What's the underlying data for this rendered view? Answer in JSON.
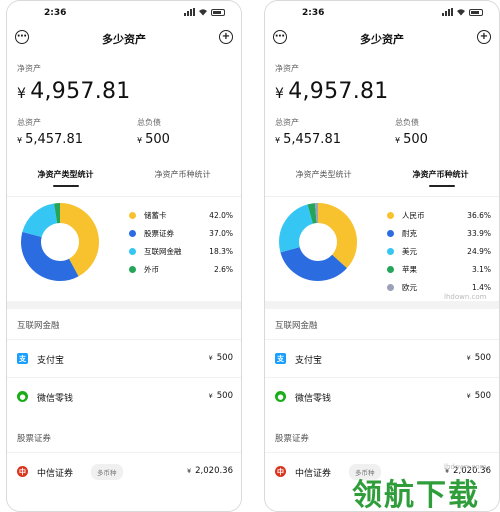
{
  "colors": {
    "yellow": "#f7c22e",
    "blue": "#2b6ce0",
    "cyan": "#35c6f4",
    "green": "#25a55a",
    "gray": "#9aa1b8",
    "alipay": "#1a9fff",
    "wechat": "#1aad19",
    "citic": "#d9341f"
  },
  "screens": [
    {
      "status": {
        "time": "2:36"
      },
      "nav": {
        "title": "多少资产"
      },
      "net_assets": {
        "label": "净资产",
        "currency": "¥",
        "value": "4,957.81"
      },
      "total_assets": {
        "label": "总资产",
        "currency": "¥",
        "value": "5,457.81"
      },
      "total_liabilities": {
        "label": "总负债",
        "currency": "¥",
        "value": "500"
      },
      "tabs": [
        {
          "label": "净资产类型统计"
        },
        {
          "label": "净资产币种统计"
        }
      ],
      "active_tab": 0,
      "legend": [
        {
          "name": "储蓄卡",
          "pct": "42.0%",
          "color": "yellow"
        },
        {
          "name": "股票证券",
          "pct": "37.0%",
          "color": "blue"
        },
        {
          "name": "互联网金融",
          "pct": "18.3%",
          "color": "cyan"
        },
        {
          "name": "外币",
          "pct": "2.6%",
          "color": "green"
        }
      ],
      "sections": [
        {
          "title": "互联网金融",
          "accounts": [
            {
              "name": "支付宝",
              "icon": "alipay-icon",
              "currency": "¥",
              "amount": "500"
            },
            {
              "name": "微信零钱",
              "icon": "wechat-icon",
              "currency": "¥",
              "amount": "500"
            }
          ]
        },
        {
          "title": "股票证券",
          "accounts": [
            {
              "name": "中信证券",
              "icon": "citic-icon",
              "tag": "多币种",
              "currency": "¥",
              "amount": "2,020.36"
            }
          ]
        }
      ]
    },
    {
      "status": {
        "time": "2:36"
      },
      "nav": {
        "title": "多少资产"
      },
      "net_assets": {
        "label": "净资产",
        "currency": "¥",
        "value": "4,957.81"
      },
      "total_assets": {
        "label": "总资产",
        "currency": "¥",
        "value": "5,457.81"
      },
      "total_liabilities": {
        "label": "总负债",
        "currency": "¥",
        "value": "500"
      },
      "tabs": [
        {
          "label": "净资产类型统计"
        },
        {
          "label": "净资产币种统计"
        }
      ],
      "active_tab": 1,
      "legend": [
        {
          "name": "人民币",
          "pct": "36.6%",
          "color": "yellow"
        },
        {
          "name": "耐克",
          "pct": "33.9%",
          "color": "blue"
        },
        {
          "name": "美元",
          "pct": "24.9%",
          "color": "cyan"
        },
        {
          "name": "苹果",
          "pct": "3.1%",
          "color": "green"
        },
        {
          "name": "欧元",
          "pct": "1.4%",
          "color": "gray"
        }
      ],
      "sections": [
        {
          "title": "互联网金融",
          "accounts": [
            {
              "name": "支付宝",
              "icon": "alipay-icon",
              "currency": "¥",
              "amount": "500"
            },
            {
              "name": "微信零钱",
              "icon": "wechat-icon",
              "currency": "¥",
              "amount": "500"
            }
          ]
        },
        {
          "title": "股票证券",
          "accounts": [
            {
              "name": "中信证券",
              "icon": "citic-icon",
              "tag": "多币种",
              "currency": "¥",
              "amount": "2,020.36"
            }
          ]
        }
      ]
    }
  ],
  "watermark": {
    "text": "领航下载",
    "site": "lhdown.com"
  }
}
